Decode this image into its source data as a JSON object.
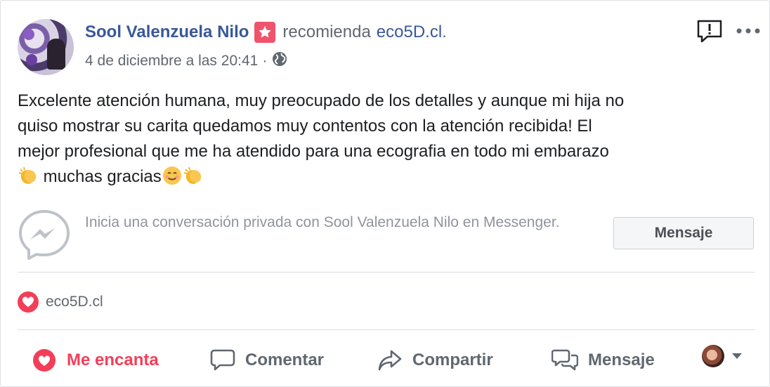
{
  "post": {
    "author": "Sool Valenzuela Nilo",
    "action_text": "recomienda",
    "page_name": "eco5D.cl",
    "trailing_period": ".",
    "timestamp": "4 de diciembre a las 20:41",
    "separator": "·",
    "privacy_icon": "globe-icon",
    "body_line1": "Excelente atención humana, muy preocupado de los detalles y aunque mi hija no",
    "body_line2": "quiso mostrar su carita quedamos muy contentos con la atención recibida! El",
    "body_line3": "mejor profesional que me ha atendido para una ecografia en todo mi embarazo",
    "body_line4": "muchas gracias"
  },
  "messenger": {
    "prompt": "Inicia una conversación privada con Sool Valenzuela Nilo en Messenger.",
    "button_label": "Mensaje"
  },
  "reactions": {
    "reactor": "eco5D.cl",
    "reaction_type": "heart"
  },
  "actions": {
    "love": "Me encanta",
    "comment": "Comentar",
    "share": "Compartir",
    "message": "Mensaje"
  },
  "colors": {
    "link_blue": "#385898",
    "love_red": "#f33e58",
    "gray_text": "#606770",
    "badge_pink": "#f0536c"
  }
}
